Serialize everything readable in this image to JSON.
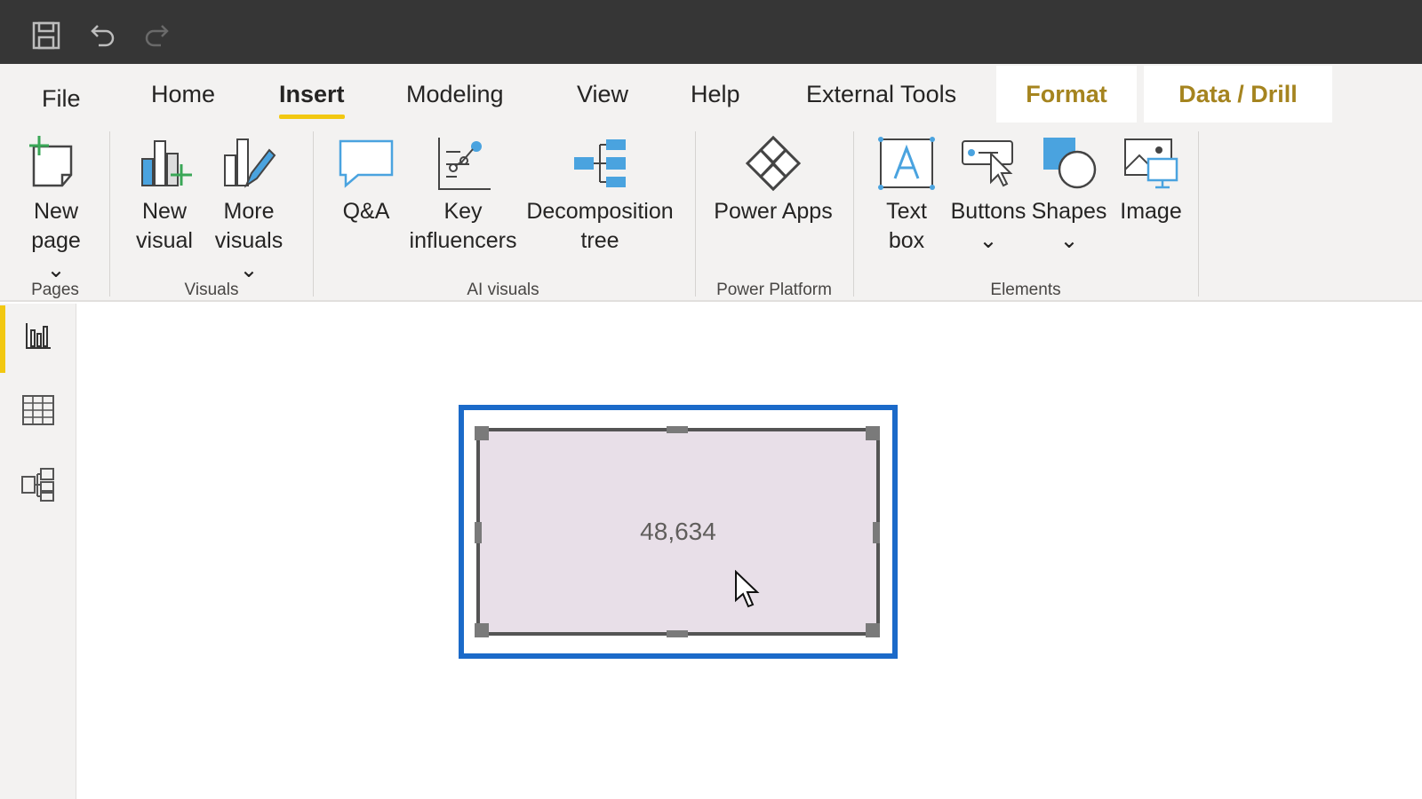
{
  "quick_access": {
    "save_icon": "save-icon",
    "undo_icon": "undo-icon",
    "redo_icon": "redo-icon"
  },
  "tabs": [
    {
      "label": "File",
      "active": false
    },
    {
      "label": "Home",
      "active": false
    },
    {
      "label": "Insert",
      "active": true
    },
    {
      "label": "Modeling",
      "active": false
    },
    {
      "label": "View",
      "active": false
    },
    {
      "label": "Help",
      "active": false
    },
    {
      "label": "External Tools",
      "active": false
    },
    {
      "label": "Format",
      "contextual": true
    },
    {
      "label": "Data / Drill",
      "contextual": true
    }
  ],
  "ribbon": {
    "groups": {
      "pages": "Pages",
      "visuals": "Visuals",
      "ai_visuals": "AI visuals",
      "power_platform": "Power Platform",
      "elements": "Elements"
    },
    "buttons": {
      "new_page": "New\npage ⌄",
      "new_visual": "New\nvisual",
      "more_visuals": "More\nvisuals ⌄",
      "qna": "Q&A",
      "key_influencers": "Key\ninfluencers",
      "decomposition_tree": "Decomposition\ntree",
      "power_apps": "Power Apps",
      "text_box": "Text\nbox",
      "buttons": "Buttons\n⌄",
      "shapes": "Shapes\n⌄",
      "image": "Image"
    }
  },
  "leftnav": [
    {
      "name": "report-view",
      "icon": "bar-chart-icon",
      "active": true
    },
    {
      "name": "data-view",
      "icon": "table-grid-icon",
      "active": false
    },
    {
      "name": "model-view",
      "icon": "model-diagram-icon",
      "active": false
    }
  ],
  "canvas": {
    "card_value": "48,634"
  },
  "colors": {
    "accent_yellow": "#f2c811",
    "selection_blue": "#1b6ac9",
    "contextual_tab_text": "#a5841f",
    "card_fill": "#e8dfe8",
    "icon_blue": "#4aa3df",
    "icon_green": "#3aa757"
  }
}
